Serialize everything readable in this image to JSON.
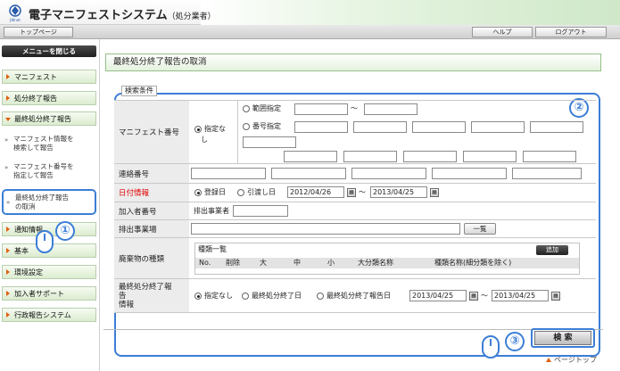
{
  "header": {
    "title": "電子マニフェストシステム",
    "subtitle": "（処分業者）",
    "logo_text": "JWnet"
  },
  "nav": {
    "top_page": "トップページ",
    "help": "ヘルプ",
    "logout": "ログアウト"
  },
  "sidebar": {
    "close_menu": "メニューを閉じる",
    "items": [
      {
        "label": "マニフェスト"
      },
      {
        "label": "処分終了報告"
      },
      {
        "label": "最終処分終了報告"
      },
      {
        "label": "通知情報"
      },
      {
        "label": "基本"
      },
      {
        "label": "環境設定"
      },
      {
        "label": "加入者サポート"
      },
      {
        "label": "行政報告システム"
      }
    ],
    "subitems": [
      {
        "line1": "マニフェスト情報を",
        "line2": "検索して報告"
      },
      {
        "line1": "マニフェスト番号を",
        "line2": "指定して報告"
      },
      {
        "line1": "最終処分終了報告",
        "line2": "の取消"
      }
    ],
    "marker": "»"
  },
  "main": {
    "page_title": "最終処分終了報告の取消",
    "legend": "検索条件",
    "manifest": {
      "label": "マニフェスト番号",
      "opt_none": "指定な",
      "opt_none2": "し",
      "opt_range": "範囲指定",
      "tilde": "〜",
      "opt_number": "番号指定"
    },
    "contact": {
      "label": "連絡番号"
    },
    "date": {
      "label": "日付情報",
      "opt_register": "登録日",
      "opt_transfer": "引渡し日",
      "from": "2012/04/26",
      "to": "2013/04/25",
      "tilde": "〜"
    },
    "member": {
      "label": "加入者番号",
      "sub_label": "排出事業者"
    },
    "site": {
      "label": "排出事業場",
      "list_button": "一覧"
    },
    "waste": {
      "label": "廃棄物の種類",
      "list_title": "種類一覧",
      "add_button": "追加",
      "columns": [
        "No.",
        "削除",
        "大",
        "中",
        "小",
        "大分類名称",
        "種類名称(細分類を除く)"
      ]
    },
    "final": {
      "label_line1": "最終処分終了報",
      "label_line2": "告",
      "label_line3": "情報",
      "opt_none": "指定なし",
      "opt_final_date": "最終処分終了日",
      "opt_report_date": "最終処分終了報告日",
      "from": "2013/04/25",
      "to": "2013/04/25",
      "tilde": "〜"
    },
    "search_button": "検 索",
    "page_top": "ページトップ"
  },
  "callouts": [
    "①",
    "②",
    "③"
  ],
  "colors": {
    "accent": "#3c7ed6",
    "menu_arrow": "#e06010",
    "required": "#e00000",
    "title_border": "#94c086"
  }
}
